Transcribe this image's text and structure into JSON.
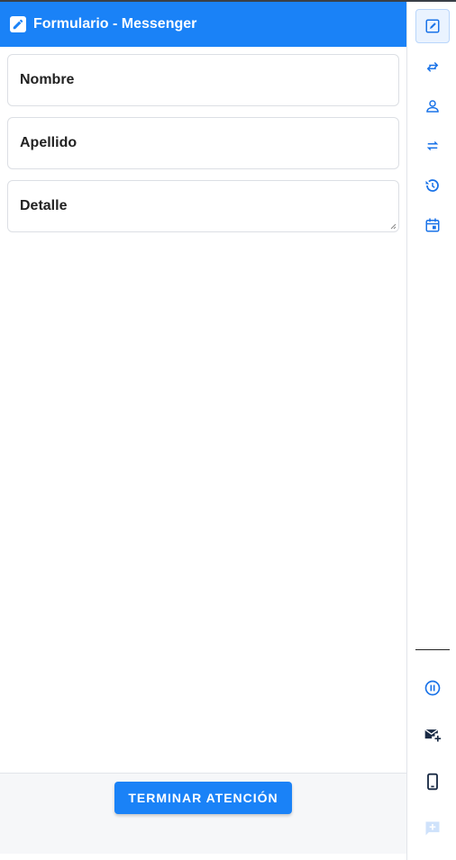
{
  "header": {
    "title": "Formulario - Messenger",
    "icon": "edit-icon",
    "color": "#1a82f7"
  },
  "form": {
    "fields": [
      {
        "label": "Nombre"
      },
      {
        "label": "Apellido"
      },
      {
        "label": "Detalle"
      }
    ]
  },
  "footer": {
    "end_button_label": "TERMINAR ATENCIÓN"
  },
  "rail": {
    "top_icons": [
      "edit-square-icon",
      "swap-arrows-icon",
      "person-icon",
      "repeat-icon",
      "history-icon",
      "calendar-icon"
    ],
    "bottom_icons": [
      "pause-icon",
      "mail-add-icon",
      "phone-icon",
      "chat-add-icon"
    ]
  }
}
